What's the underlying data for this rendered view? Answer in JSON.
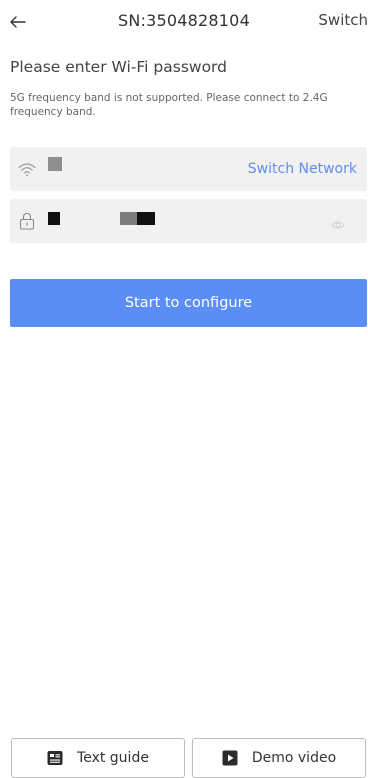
{
  "header": {
    "back_icon": "arrow-left-icon",
    "title": "SN:3504828104",
    "switch_label": "Switch"
  },
  "main": {
    "heading": "Please enter Wi-Fi password",
    "subtext": "5G frequency band is not supported. Please connect to 2.4G frequency band.",
    "ssid_field": {
      "icon": "wifi-icon",
      "value_redacted": true,
      "switch_network_label": "Switch Network"
    },
    "password_field": {
      "icon": "lock-icon",
      "value_redacted": true,
      "visibility_icon": "eye-icon"
    },
    "configure_button_label": "Start to configure"
  },
  "footer": {
    "text_guide_label": "Text guide",
    "text_guide_icon": "document-icon",
    "demo_video_label": "Demo video",
    "demo_video_icon": "play-icon"
  },
  "colors": {
    "accent": "#5a8ef4",
    "link": "#5e8ef0",
    "field_bg": "#f1f1f1"
  }
}
